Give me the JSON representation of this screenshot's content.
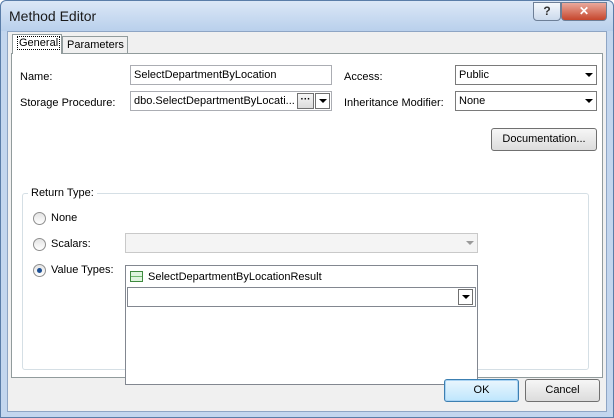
{
  "window": {
    "title": "Method Editor",
    "help_label": "?",
    "close_label": "✕"
  },
  "tabs": [
    {
      "label": "General"
    },
    {
      "label": "Parameters"
    }
  ],
  "general": {
    "name_label": "Name:",
    "name_value": "SelectDepartmentByLocation",
    "storage_label": "Storage Procedure:",
    "storage_value": "dbo.SelectDepartmentByLocati...",
    "ellipsis_label": "···",
    "access_label": "Access:",
    "access_value": "Public",
    "inheritance_label": "Inheritance Modifier:",
    "inheritance_value": "None",
    "documentation_label": "Documentation..."
  },
  "return_type": {
    "group_label": "Return Type:",
    "none_label": "None",
    "scalars_label": "Scalars:",
    "scalars_value": "",
    "value_types_label": "Value Types:",
    "selected": "value_types",
    "value_types_items": [
      {
        "label": "SelectDepartmentByLocationResult"
      }
    ]
  },
  "footer": {
    "ok_label": "OK",
    "cancel_label": "Cancel"
  }
}
